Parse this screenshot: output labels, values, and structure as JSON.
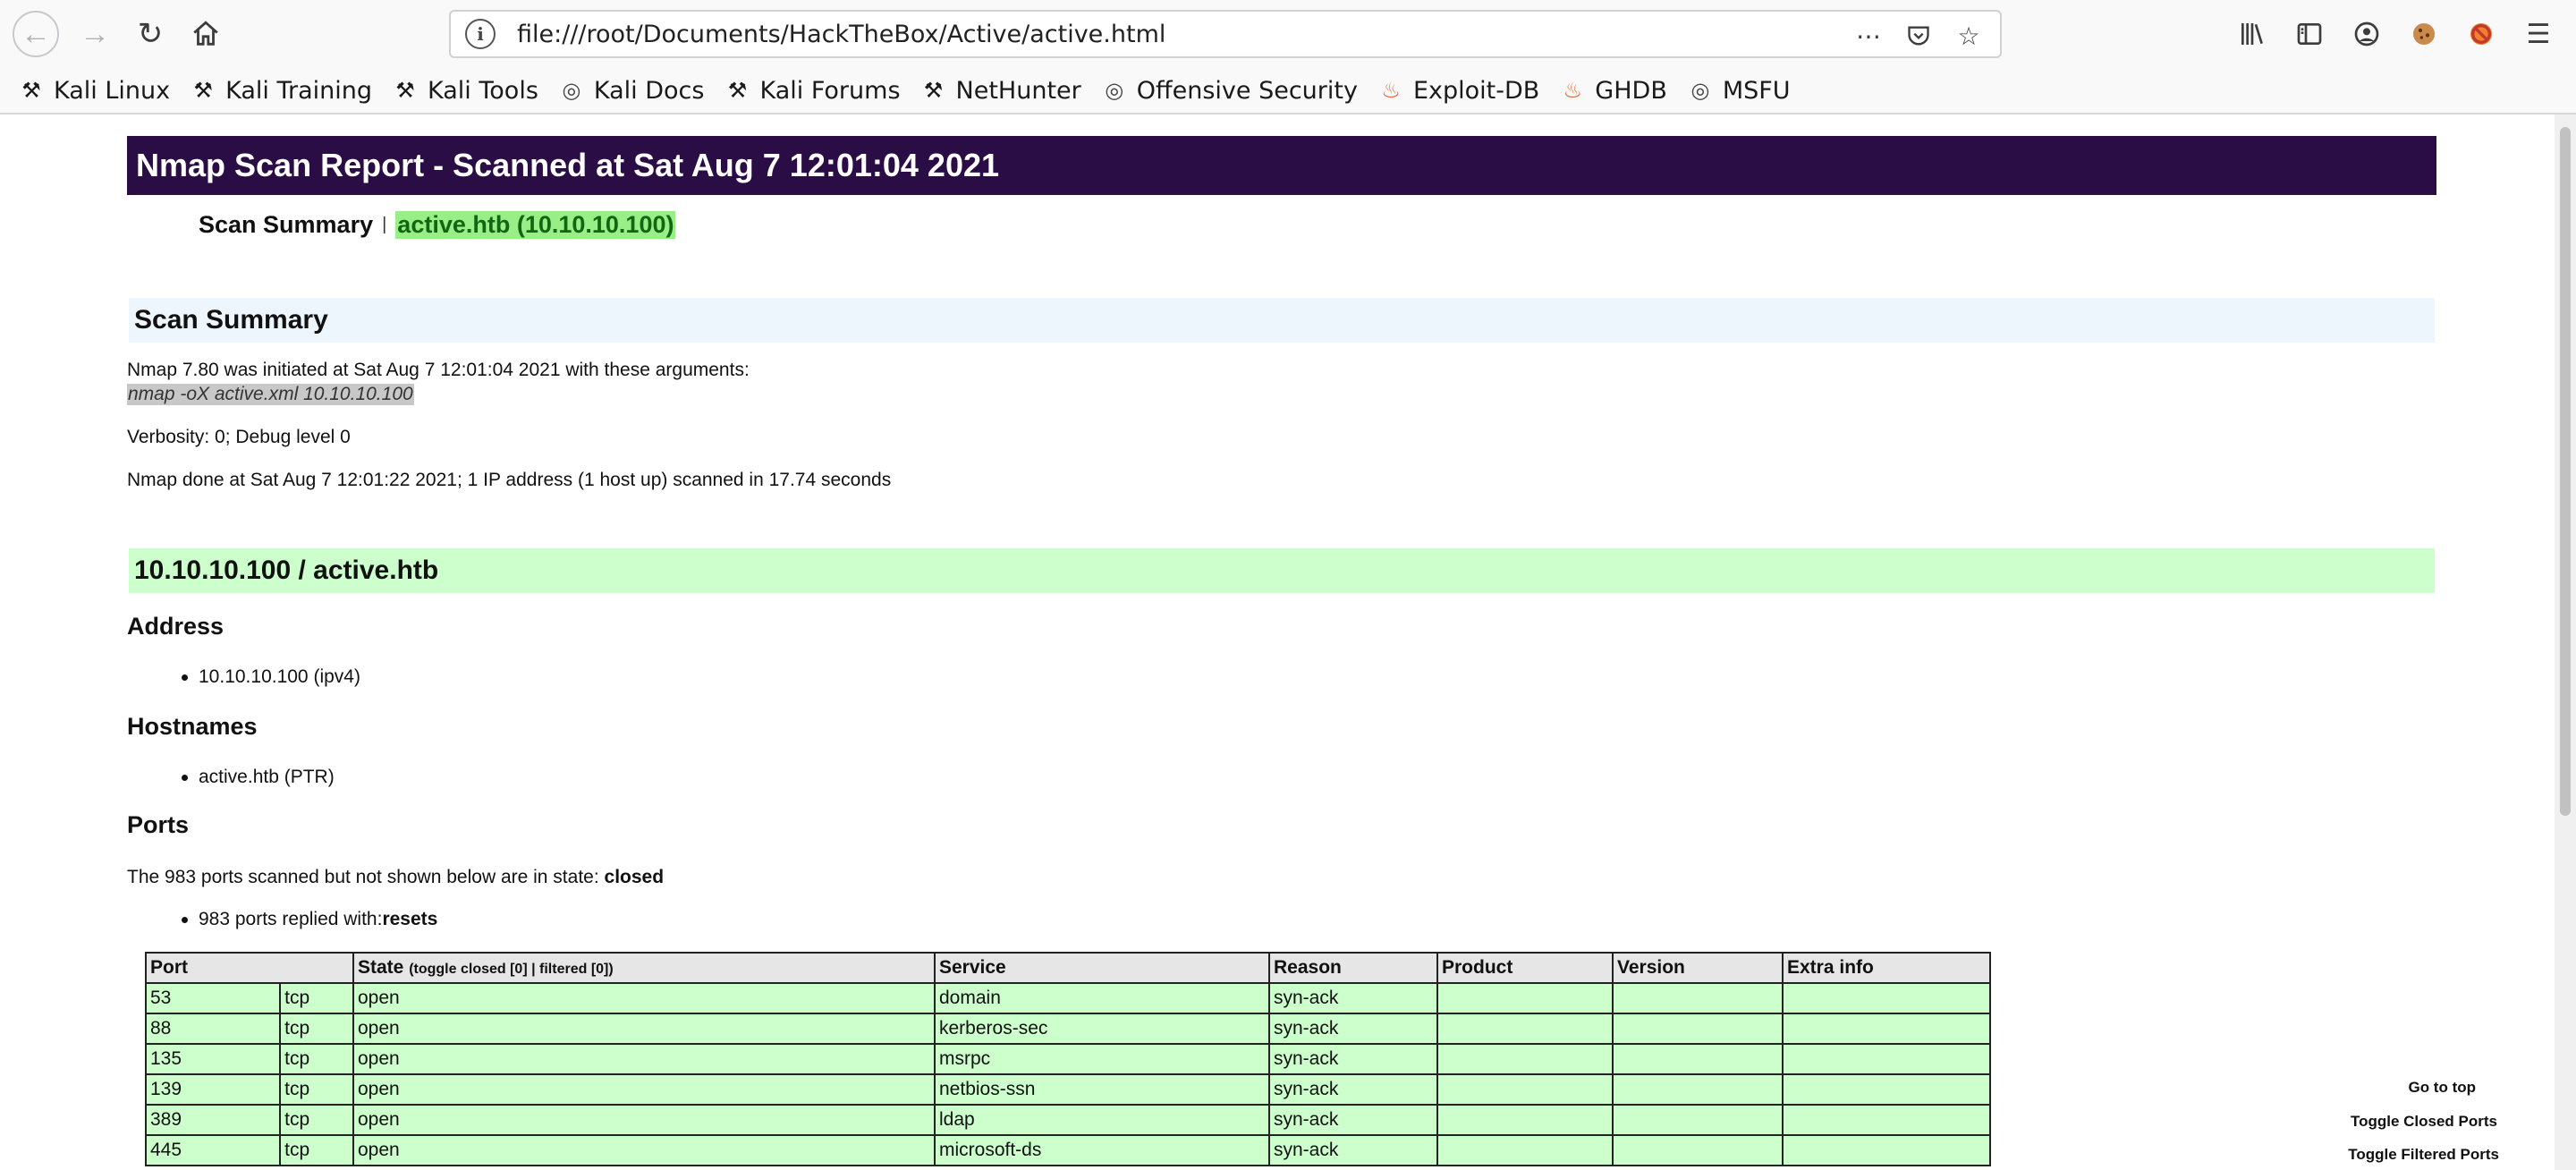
{
  "browser": {
    "url": "file:///root/Documents/HackTheBox/Active/active.html",
    "bookmarks": [
      {
        "label": "Kali Linux",
        "icon": "kali-dragon-icon"
      },
      {
        "label": "Kali Training",
        "icon": "kali-dragon-icon"
      },
      {
        "label": "Kali Tools",
        "icon": "kali-dragon-icon"
      },
      {
        "label": "Kali Docs",
        "icon": "globe-icon"
      },
      {
        "label": "Kali Forums",
        "icon": "kali-dragon-icon"
      },
      {
        "label": "NetHunter",
        "icon": "kali-dragon-icon"
      },
      {
        "label": "Offensive Security",
        "icon": "globe-icon"
      },
      {
        "label": "Exploit-DB",
        "icon": "exploitdb-icon"
      },
      {
        "label": "GHDB",
        "icon": "exploitdb-icon"
      },
      {
        "label": "MSFU",
        "icon": "globe-icon"
      }
    ]
  },
  "report": {
    "title": "Nmap Scan Report - Scanned at Sat Aug 7 12:01:04 2021",
    "nav_summary": "Scan Summary",
    "nav_sep": "|",
    "nav_host": "active.htb (10.10.10.100)"
  },
  "summary": {
    "heading": "Scan Summary",
    "initiated": "Nmap 7.80 was initiated at Sat Aug 7 12:01:04 2021 with these arguments:",
    "arguments": "nmap -oX active.xml 10.10.10.100",
    "verbosity": "Verbosity: 0; Debug level 0",
    "done": "Nmap done at Sat Aug 7 12:01:22 2021; 1 IP address (1 host up) scanned in 17.74 seconds"
  },
  "host": {
    "heading": "10.10.10.100 / active.htb",
    "address_heading": "Address",
    "address": "10.10.10.100 (ipv4)",
    "hostnames_heading": "Hostnames",
    "hostname": "active.htb (PTR)",
    "ports_heading": "Ports",
    "ports_note_prefix": "The 983 ports scanned but not shown below are in state: ",
    "ports_note_state": "closed",
    "replied_prefix": "983 ports replied with: ",
    "replied_reason": "resets"
  },
  "ports_table": {
    "headers": {
      "port": "Port",
      "state": "State",
      "state_toggle": "(toggle closed [0] | filtered [0])",
      "service": "Service",
      "reason": "Reason",
      "product": "Product",
      "version": "Version",
      "extra": "Extra info"
    },
    "rows": [
      {
        "port": "53",
        "proto": "tcp",
        "state": "open",
        "service": "domain",
        "reason": "syn-ack"
      },
      {
        "port": "88",
        "proto": "tcp",
        "state": "open",
        "service": "kerberos-sec",
        "reason": "syn-ack"
      },
      {
        "port": "135",
        "proto": "tcp",
        "state": "open",
        "service": "msrpc",
        "reason": "syn-ack"
      },
      {
        "port": "139",
        "proto": "tcp",
        "state": "open",
        "service": "netbios-ssn",
        "reason": "syn-ack"
      },
      {
        "port": "389",
        "proto": "tcp",
        "state": "open",
        "service": "ldap",
        "reason": "syn-ack"
      },
      {
        "port": "445",
        "proto": "tcp",
        "state": "open",
        "service": "microsoft-ds",
        "reason": "syn-ack"
      }
    ]
  },
  "side_links": {
    "top": "Go to top",
    "closed": "Toggle Closed Ports",
    "filtered": "Toggle Filtered Ports"
  }
}
